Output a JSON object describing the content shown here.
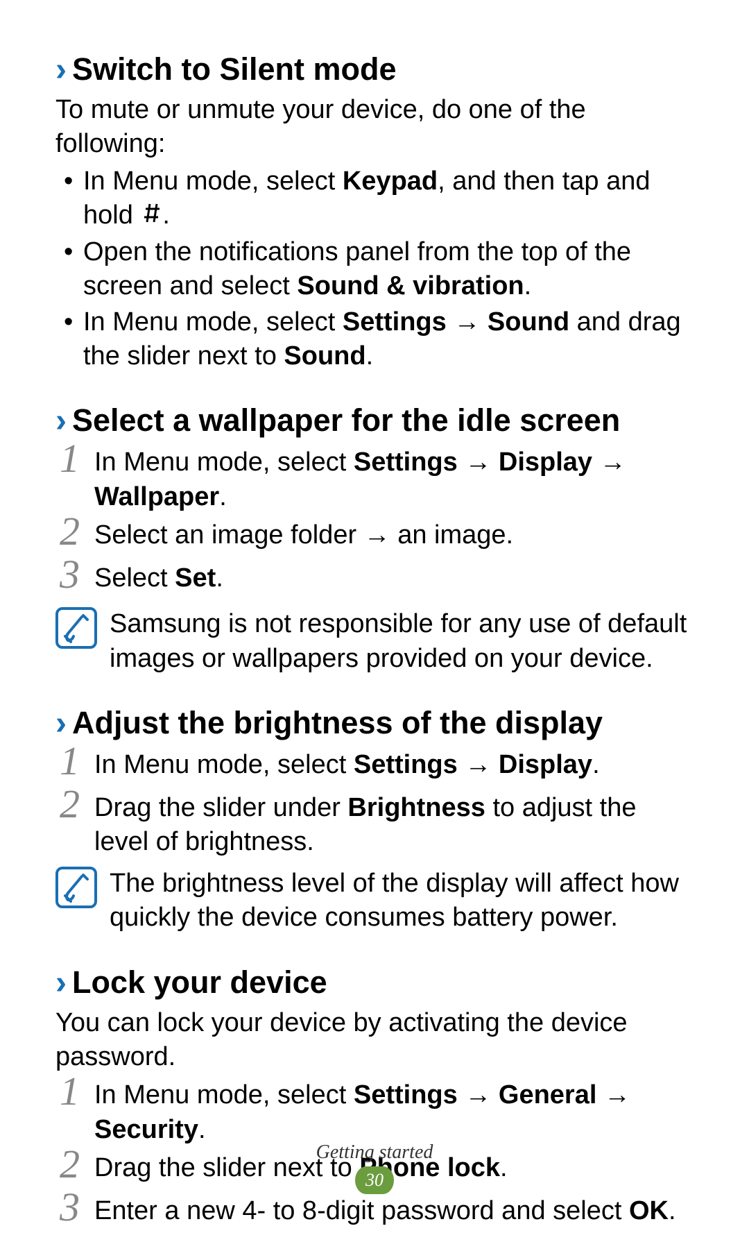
{
  "sections": {
    "silent": {
      "title": "Switch to Silent mode",
      "intro": "To mute or unmute your device, do one of the following:",
      "bullets": {
        "b1_pre": "In Menu mode, select ",
        "b1_bold": "Keypad",
        "b1_post": ", and then tap and hold ",
        "b2_pre": "Open the notifications panel from the top of the screen and select ",
        "b2_bold": "Sound & vibration",
        "b2_post": ".",
        "b3_pre": "In Menu mode, select ",
        "b3_bold1": "Settings",
        "b3_arrow": " → ",
        "b3_bold2": "Sound",
        "b3_mid": " and drag the slider next to ",
        "b3_bold3": "Sound",
        "b3_post": "."
      }
    },
    "wallpaper": {
      "title": "Select a wallpaper for the idle screen",
      "steps": {
        "s1_pre": "In Menu mode, select ",
        "s1_b1": "Settings",
        "s1_a1": " → ",
        "s1_b2": "Display",
        "s1_a2": " → ",
        "s1_b3": "Wallpaper",
        "s1_post": ".",
        "s2": "Select an image folder → an image.",
        "s3_pre": "Select ",
        "s3_bold": "Set",
        "s3_post": "."
      },
      "note": "Samsung is not responsible for any use of default images or wallpapers provided on your device."
    },
    "brightness": {
      "title": "Adjust the brightness of the display",
      "steps": {
        "s1_pre": "In Menu mode, select ",
        "s1_b1": "Settings",
        "s1_a1": " → ",
        "s1_b2": "Display",
        "s1_post": ".",
        "s2_pre": "Drag the slider under ",
        "s2_bold": "Brightness",
        "s2_post": " to adjust the level of brightness."
      },
      "note": "The brightness level of the display will affect how quickly the device consumes battery power."
    },
    "lock": {
      "title": "Lock your device",
      "intro": "You can lock your device by activating the device password.",
      "steps": {
        "s1_pre": "In Menu mode, select ",
        "s1_b1": "Settings",
        "s1_a1": " → ",
        "s1_b2": "General",
        "s1_a2": " → ",
        "s1_b3": "Security",
        "s1_post": ".",
        "s2_pre": "Drag the slider next to ",
        "s2_bold": "Phone lock",
        "s2_post": ".",
        "s3_pre": "Enter a new 4- to 8-digit password and select ",
        "s3_bold": "OK",
        "s3_post": "."
      }
    }
  },
  "nums": {
    "n1": "1",
    "n2": "2",
    "n3": "3"
  },
  "footer": {
    "label": "Getting started",
    "page": "30"
  }
}
